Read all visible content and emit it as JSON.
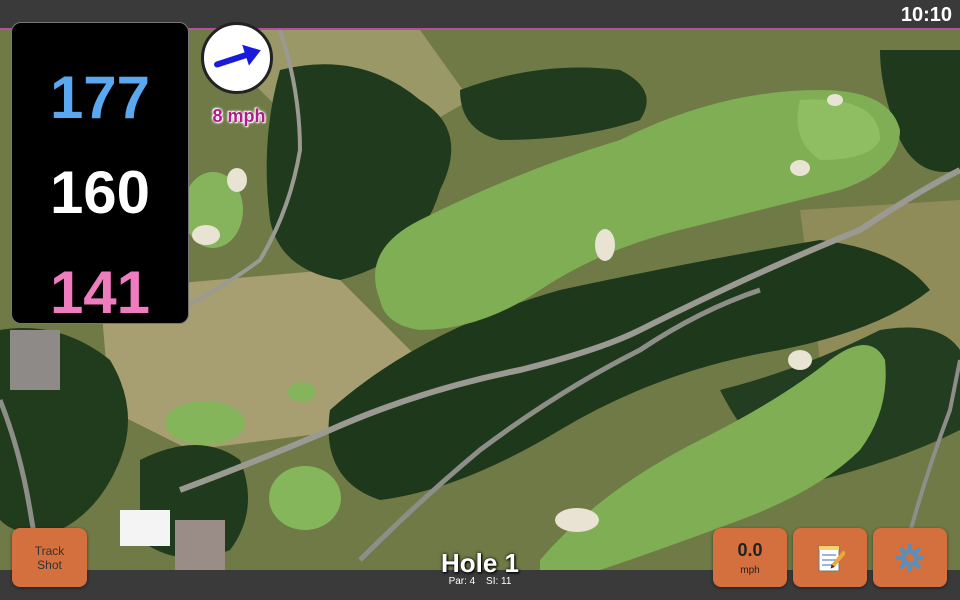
{
  "status_bar": {
    "time": "10:10"
  },
  "distances": {
    "back": "177",
    "middle": "160",
    "front": "141"
  },
  "wind": {
    "speed_text": "8 mph",
    "arrow_icon": "arrow-right-icon",
    "direction": "northeast"
  },
  "track_shot": {
    "label_line1": "Track",
    "label_line2": "Shot"
  },
  "speed": {
    "value": "0.0",
    "unit": "mph"
  },
  "notes_button": {
    "icon": "notepad-icon"
  },
  "settings_button": {
    "icon": "gear-icon"
  },
  "hole": {
    "title": "Hole 1",
    "par": "Par: 4",
    "si": "SI: 11"
  },
  "colors": {
    "back": "#5aa9f0",
    "middle": "#ffffff",
    "front": "#f07cc0",
    "button": "#d4703d",
    "accent": "#b64fa0"
  }
}
